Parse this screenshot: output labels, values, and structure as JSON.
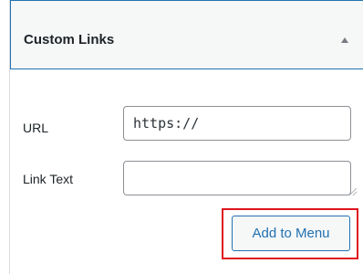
{
  "panel": {
    "title": "Custom Links"
  },
  "form": {
    "url_label": "URL",
    "url_value": "https://",
    "link_text_label": "Link Text",
    "link_text_value": "",
    "add_button_label": "Add to Menu"
  },
  "icons": {
    "collapse": "triangle-up-icon"
  },
  "colors": {
    "accent": "#2271b1",
    "highlight": "#e0141e",
    "header_bg": "#f6f7f7"
  }
}
